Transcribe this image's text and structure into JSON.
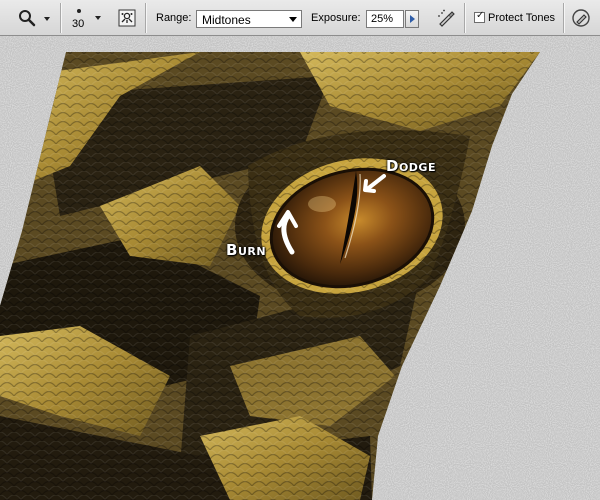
{
  "toolbar": {
    "tool_icon": "zoom-magnifier-icon",
    "brush_size": "30",
    "brush_panel_icon": "brush-panel-icon",
    "range_label": "Range:",
    "range_value": "Midtones",
    "exposure_label": "Exposure:",
    "exposure_value": "25%",
    "airbrush_icon": "airbrush-icon",
    "protect_tones_checked": true,
    "protect_tones_label": "Protect Tones",
    "pressure_icon": "tablet-pressure-icon"
  },
  "annotations": {
    "dodge": {
      "cap": "D",
      "rest": "odge"
    },
    "burn": {
      "cap": "B",
      "rest": "urn"
    }
  },
  "colors": {
    "toolbar_bg": "#dcdcdc",
    "canvas_noise": "#b4b4b4",
    "snake_gold": "#b89a3a",
    "snake_dark": "#2a2212",
    "eye_amber": "#7a4a14"
  }
}
